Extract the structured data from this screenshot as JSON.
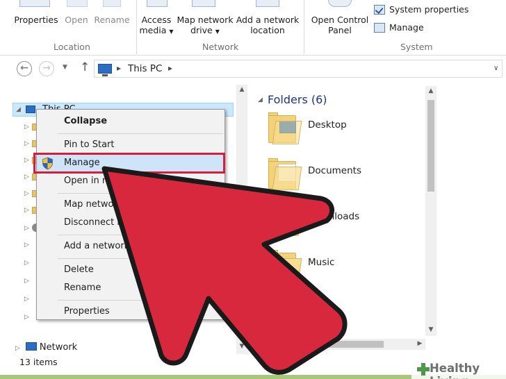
{
  "ribbon": {
    "computer": {
      "properties": "Properties",
      "open": "Open",
      "rename": "Rename",
      "group": "Location"
    },
    "network": {
      "access_media_1": "Access",
      "access_media_2": "media",
      "map_drive_1": "Map network",
      "map_drive_2": "drive",
      "add_location_1": "Add a network",
      "add_location_2": "location",
      "group": "Network"
    },
    "system": {
      "open_cp_1": "Open Control",
      "open_cp_2": "Panel",
      "system_properties": "System properties",
      "manage": "Manage",
      "group": "System"
    }
  },
  "address_bar": {
    "path": "This PC"
  },
  "nav_pane": {
    "this_pc": "This PC",
    "network": "Network",
    "status": "13 items"
  },
  "content": {
    "section_title": "Folders (6)",
    "folders": [
      "Desktop",
      "Documents",
      "Downloads",
      "Music"
    ]
  },
  "context_menu": {
    "items": [
      "Collapse",
      "Pin to Start",
      "Manage",
      "Open in n",
      "Map network",
      "Disconnect netw",
      "Add a network locat",
      "Delete",
      "Rename",
      "Properties"
    ]
  },
  "colors": {
    "accent_highlight": "#d51f3a",
    "arrow_fill": "#d8283d",
    "selection": "#cfe4f8",
    "folder_header": "#1e3287"
  },
  "icons": {
    "back": "back-arrow-icon",
    "forward": "forward-arrow-icon",
    "up": "up-arrow-icon",
    "shield": "uac-shield-icon"
  },
  "watermark": {
    "text": "Healthy Living"
  }
}
